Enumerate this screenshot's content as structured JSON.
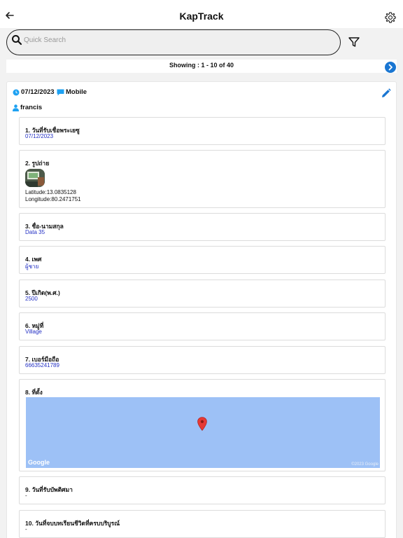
{
  "app": {
    "title": "KapTrack"
  },
  "icons": {
    "back": "arrow-left-icon",
    "settings": "gear-icon",
    "search": "search-icon",
    "filter": "filter-icon",
    "next": "chevron-right-icon",
    "edit": "pencil-icon",
    "clock": "clock-icon",
    "chat": "chat-icon",
    "user": "user-icon",
    "pin": "map-pin-icon"
  },
  "colors": {
    "accent": "#1976d2",
    "value_text": "#2330c4",
    "map_water": "#9dc1f6",
    "pin": "#e53935"
  },
  "search": {
    "placeholder": "Quick Search",
    "value": ""
  },
  "pager": {
    "text": "Showing : 1 - 10 of 40"
  },
  "record": {
    "date": "07/12/2023",
    "source": "Mobile",
    "user": "francis",
    "fields": [
      {
        "label": "1. วันที่รับเชื่อพระเยซู",
        "value": "07/12/2023"
      },
      {
        "label": "2. รูปถ่าย",
        "latitude": "Latitude:13.0835128",
        "longitude": "Longitude:80.2471751"
      },
      {
        "label": "3. ชื่อ-นามสกุล",
        "value": "Data 35"
      },
      {
        "label": "4. เพศ",
        "value": "ผู้ชาย"
      },
      {
        "label": "5. ปีเกิด(พ.ศ.)",
        "value": "2500"
      },
      {
        "label": "6. หมู่ที่",
        "value": "Village"
      },
      {
        "label": "7. เบอร์มือถือ",
        "value": "66635241789"
      },
      {
        "label": "8. ที่ตั้ง",
        "map_logo": "Google",
        "map_copyright": "©2023 Google"
      },
      {
        "label": "9. วันที่รับบัพติศมา",
        "value": "-"
      },
      {
        "label": "10. วันที่จบบทเรียนชีวิตที่ครบบริบูรณ์",
        "value": "-"
      }
    ]
  }
}
